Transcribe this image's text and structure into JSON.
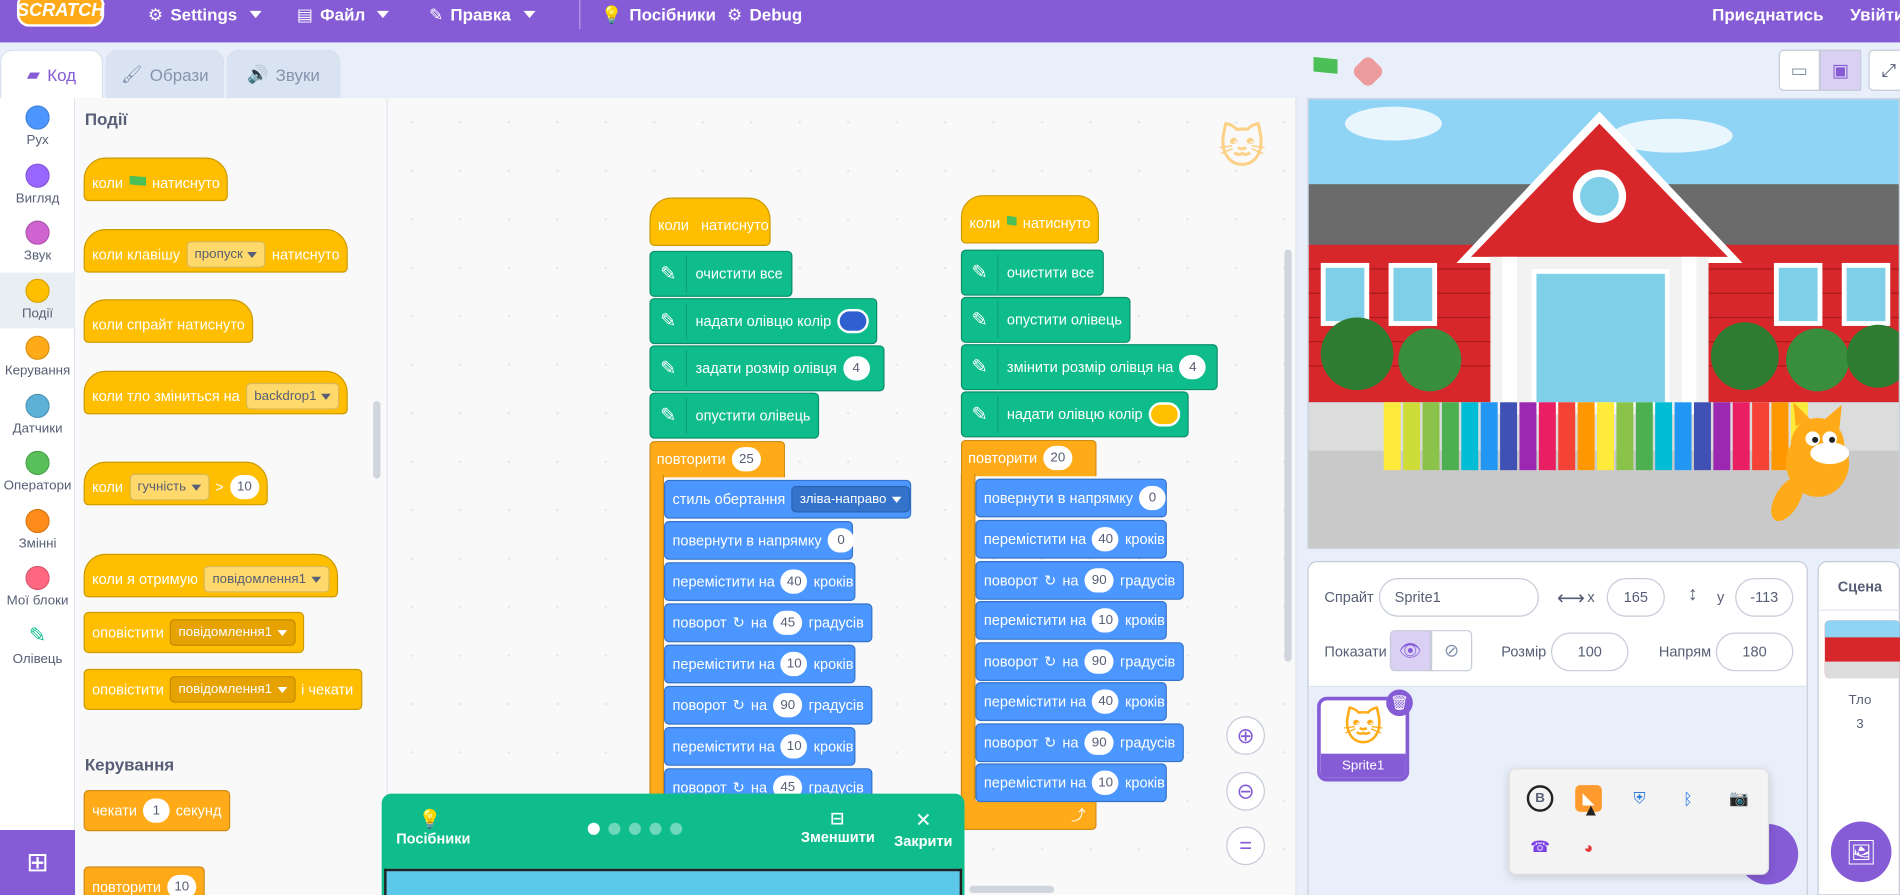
{
  "menu": {
    "logo": "SCRATCH",
    "settings": "Settings",
    "file": "Файл",
    "edit": "Правка",
    "tutorials": "Посібники",
    "debug": "Debug",
    "join": "Приєднатись",
    "signin": "Увійти"
  },
  "tabs": {
    "code": "Код",
    "costumes": "Образи",
    "sounds": "Звуки"
  },
  "categories": [
    {
      "label": "Рух",
      "color": "#4c97ff"
    },
    {
      "label": "Вигляд",
      "color": "#9966ff"
    },
    {
      "label": "Звук",
      "color": "#cf63cf"
    },
    {
      "label": "Події",
      "color": "#ffbf00"
    },
    {
      "label": "Керування",
      "color": "#ffab19"
    },
    {
      "label": "Датчики",
      "color": "#5cb1d6"
    },
    {
      "label": "Оператори",
      "color": "#59c059"
    },
    {
      "label": "Змінні",
      "color": "#ff8c1a"
    },
    {
      "label": "Мої блоки",
      "color": "#ff6680"
    },
    {
      "label": "Олівець",
      "color": "#0fbd8c"
    }
  ],
  "palette": {
    "events_title": "Події",
    "when_flag": "коли",
    "clicked": "натиснуто",
    "when_key": "коли клавішу",
    "key_value": "пропуск",
    "key_clicked": "натиснуто",
    "when_sprite": "коли спрайт натиснуто",
    "when_backdrop": "коли тло зміниться на",
    "backdrop_value": "backdrop1",
    "when_loud": "коли",
    "loud_value": "гучність",
    "gt": ">",
    "loud_num": "10",
    "when_receive": "коли я отримую",
    "msg1": "повідомлення1",
    "broadcast": "оповістити",
    "broadcast_msg": "повідомлення1",
    "broadcast_wait": "оповістити",
    "broadcast_wait_msg": "повідомлення1",
    "and_wait": "і чекати",
    "control_title": "Керування",
    "wait": "чекати",
    "wait_num": "1",
    "seconds": "секунд",
    "repeat": "повторити",
    "repeat_num": "10"
  },
  "script1": {
    "hat_when": "коли",
    "hat_clicked": "натиснуто",
    "clear": "очистити все",
    "set_color": "надати олівцю колір",
    "color1": "#3060d0",
    "set_size": "задати розмір олівця",
    "size_val": "4",
    "pen_down": "опустити олівець",
    "repeat": "повторити",
    "repeat_val": "25",
    "rotstyle": "стиль обертання",
    "rotstyle_val": "зліва-направо",
    "point_dir": "повернути в напрямку",
    "dir_val": "0",
    "move1": "перемістити на",
    "move1_val": "40",
    "steps": "кроків",
    "turn1": "поворот",
    "turn1_on": "на",
    "turn1_val": "45",
    "degrees": "градусів",
    "move2": "перемістити на",
    "move2_val": "10",
    "turn2": "поворот",
    "turn2_on": "на",
    "turn2_val": "90",
    "move3": "перемістити на",
    "move3_val": "10",
    "turn3": "поворот",
    "turn3_on": "на",
    "turn3_val": "45"
  },
  "script2": {
    "hat_when": "коли",
    "hat_clicked": "натиснуто",
    "clear": "очистити все",
    "pen_down": "опустити олівець",
    "change_size": "змінити розмір олівця на",
    "size_val": "4",
    "set_color": "надати олівцю колір",
    "color2": "#ffc000",
    "repeat": "повторити",
    "repeat_val": "20",
    "point_dir": "повернути в напрямку",
    "dir_val": "0",
    "move1": "перемістити на",
    "move1_val": "40",
    "steps": "кроків",
    "turn1": "поворот",
    "turn_on": "на",
    "turn1_val": "90",
    "degrees": "градусів",
    "move2": "перемістити на",
    "move2_val": "10",
    "turn2": "поворот",
    "turn2_val": "90",
    "move3": "перемістити на",
    "move3_val": "40",
    "turn3": "поворот",
    "turn3_val": "90",
    "move4": "перемістити на",
    "move4_val": "10"
  },
  "tutorial": {
    "label": "Посібники",
    "shrink": "Зменшити",
    "close": "Закрити",
    "step_count": 5,
    "active_step": 1
  },
  "sprite": {
    "sprite_label": "Спрайт",
    "name": "Sprite1",
    "x_label": "x",
    "x": "165",
    "y_label": "y",
    "y": "-113",
    "show_label": "Показати",
    "size_label": "Розмір",
    "size": "100",
    "dir_label": "Напрям",
    "direction": "180",
    "thumb_name": "Sprite1"
  },
  "scene": {
    "title": "Сцена",
    "backdrops_label": "Тло",
    "backdrops_count": "3"
  }
}
